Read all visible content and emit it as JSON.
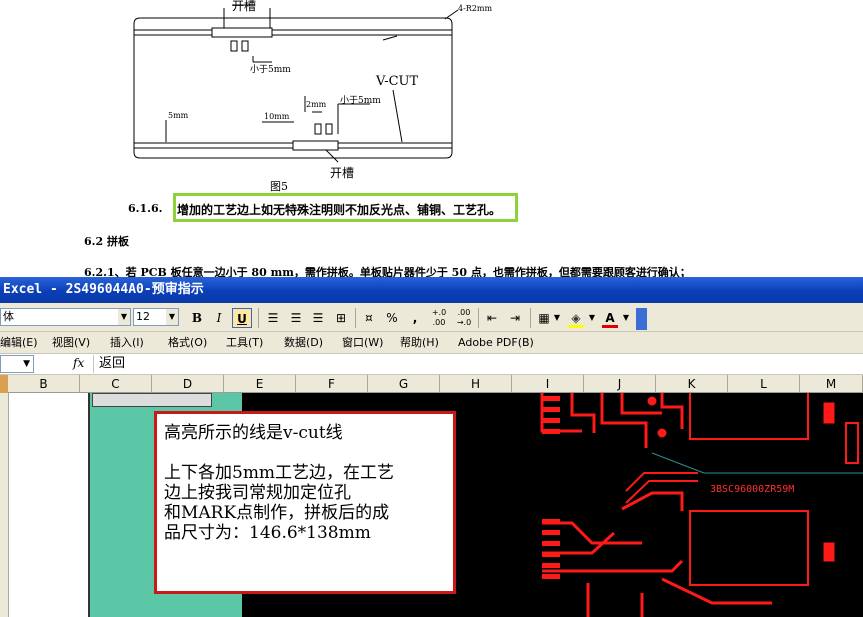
{
  "document": {
    "fig_labels": {
      "open_slot_top": "开槽",
      "corner": "4-R2mm",
      "lt5mm_1": "小于5mm",
      "vcut": "V-CUT",
      "lt5mm_2": "小于5mm",
      "dim_2mm": "2mm",
      "dim_10mm": "10mm",
      "dim_5mm": "5mm",
      "open_slot_bottom": "开槽",
      "figure": "图5"
    },
    "sec_616_num": "6.1.6.",
    "sec_616_text": "增加的工艺边上如无特殊注明则不加反光点、铺铜、工艺孔。",
    "sec_62": "6.2 拼板",
    "sec_621": "6.2.1、若 PCB 板任意一边小于 80 mm，需作拼板。单板贴片器件少于 50 点，也需作拼板，但都需要跟顾客进行确认；"
  },
  "excel": {
    "title": "Excel - 2S496044A0-预审指示",
    "font_name": "体",
    "font_size": "12",
    "toolbar": {
      "bold": "B",
      "italic": "I",
      "underline": "U",
      "percent": "%",
      "comma": ",",
      "inc_decimal": "+.0 .00",
      "dec_decimal": ".00 →.0",
      "font_color_letter": "A"
    },
    "menu": [
      "编辑(E)",
      "视图(V)",
      "插入(I)",
      "格式(O)",
      "工具(T)",
      "数据(D)",
      "窗口(W)",
      "帮助(H)",
      "Adobe PDF(B)"
    ],
    "fx_label": "fx",
    "formula_value": "返回",
    "columns": [
      "B",
      "C",
      "D",
      "E",
      "F",
      "G",
      "H",
      "I",
      "J",
      "K",
      "L",
      "M"
    ],
    "pcb_label": "3BSC96000ZR59M"
  },
  "callout": {
    "line1": "高亮所示的线是v-cut线",
    "line2": "上下各加5mm工艺边，在工艺",
    "line3": "边上按我司常规加定位孔",
    "line4": "和MARK点制作，拼板后的成",
    "line5": "品尺寸为：146.6*138mm"
  },
  "colors": {
    "highlight_border": "#8ed23a",
    "callout_border": "#c81818",
    "pcb_trace": "#ff1a1a",
    "pcb_bg": "#000000",
    "teal": "#5cc7a7",
    "titlebar": "#0a3fb8"
  }
}
